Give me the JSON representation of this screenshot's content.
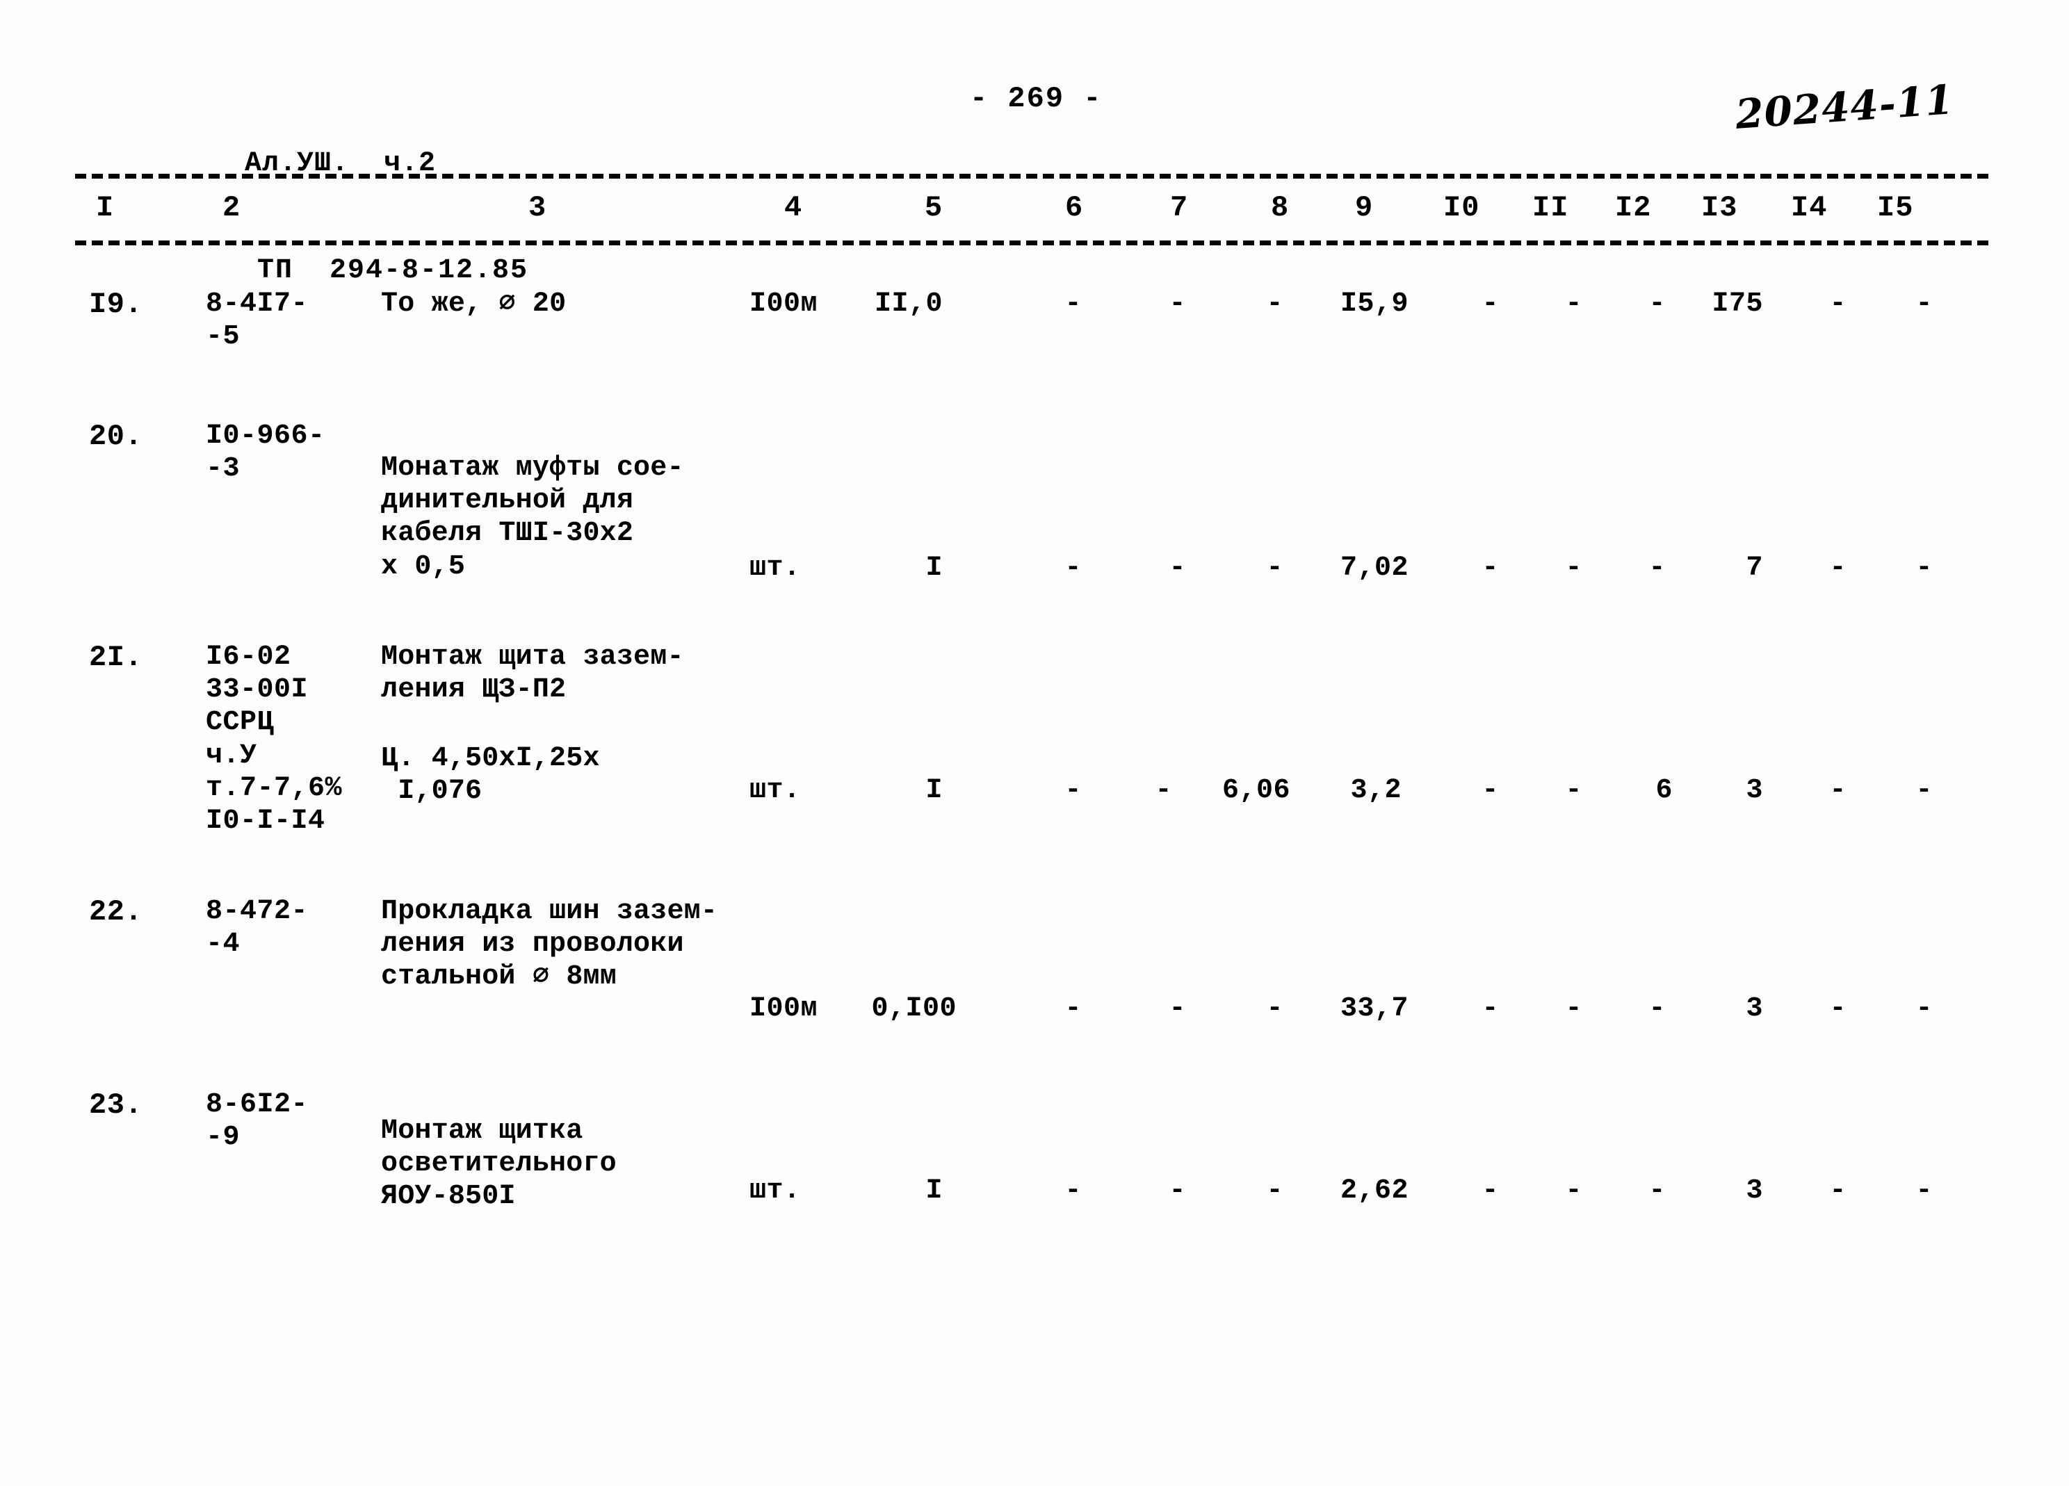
{
  "header": {
    "left_line1": "Ал.УШ.  ч.2",
    "left_line2": "ТП  294-8-12.85",
    "page_number": "- 269 -",
    "stamp": "20244-11"
  },
  "table": {
    "column_headers": [
      "I",
      "2",
      "3",
      "4",
      "5",
      "6",
      "7",
      "8",
      "9",
      "I0",
      "II",
      "I2",
      "I3",
      "I4",
      "I5"
    ],
    "rows": [
      {
        "no": "I9.",
        "code": "8-4I7-\n-5",
        "description": "То же, ⌀ 20",
        "unit": "I00м",
        "c5": "II,0",
        "c6": "-",
        "c7": "-",
        "c8": "-",
        "c9": "I5,9",
        "c10": "-",
        "c11": "-",
        "c12": "-",
        "c13": "I75",
        "c14": "-",
        "c15": "-"
      },
      {
        "no": "20.",
        "code": "I0-966-\n-3",
        "description": "Монатаж муфты сое-\nдинительной для\nкабеля ТШI-30х2\nх 0,5",
        "unit": "шт.",
        "c5": "I",
        "c6": "-",
        "c7": "-",
        "c8": "-",
        "c9": "7,02",
        "c10": "-",
        "c11": "-",
        "c12": "-",
        "c13": "7",
        "c14": "-",
        "c15": "-"
      },
      {
        "no": "2I.",
        "code": "I6-02\n33-00I\nССРЦ\nч.У\nт.7-7,6%\nI0-I-I4",
        "description": "Монтаж щита зазем-\nления ЩЗ-П2",
        "description2": "Ц. 4,50хI,25х\n I,076",
        "unit": "шт.",
        "c5": "I",
        "c6": "-",
        "c7": "-",
        "c8": "6,06",
        "c9": "3,2",
        "c10": "-",
        "c11": "-",
        "c12": "6",
        "c13": "3",
        "c14": "-",
        "c15": "-"
      },
      {
        "no": "22.",
        "code": "8-472-\n-4",
        "description": "Прокладка шин зазем-\nления из проволоки\nстальной ⌀ 8мм",
        "unit": "I00м",
        "c5": "0,I00",
        "c6": "-",
        "c7": "-",
        "c8": "-",
        "c9": "33,7",
        "c10": "-",
        "c11": "-",
        "c12": "-",
        "c13": "3",
        "c14": "-",
        "c15": "-"
      },
      {
        "no": "23.",
        "code": "8-6I2-\n-9",
        "description": "Монтаж щитка\nосветительного\nЯОУ-850I",
        "unit": "шт.",
        "c5": "I",
        "c6": "-",
        "c7": "-",
        "c8": "-",
        "c9": "2,62",
        "c10": "-",
        "c11": "-",
        "c12": "-",
        "c13": "3",
        "c14": "-",
        "c15": "-"
      }
    ]
  }
}
